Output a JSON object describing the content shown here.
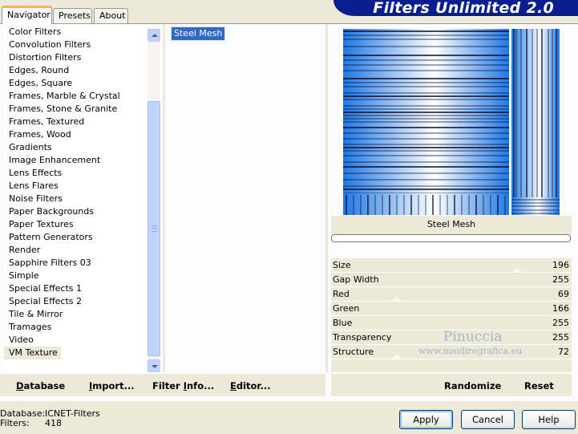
{
  "tabs": [
    {
      "label": "Navigator",
      "active": true
    },
    {
      "label": "Presets",
      "active": false
    },
    {
      "label": "About",
      "active": false
    }
  ],
  "brand": "Filters Unlimited 2.0",
  "categories": [
    "Color Filters",
    "Convolution Filters",
    "Distortion Filters",
    "Edges, Round",
    "Edges, Square",
    "Frames, Marble & Crystal",
    "Frames, Stone & Granite",
    "Frames, Textured",
    "Frames, Wood",
    "Gradients",
    "Image Enhancement",
    "Lens Effects",
    "Lens Flares",
    "Noise Filters",
    "Paper Backgrounds",
    "Paper Textures",
    "Pattern Generators",
    "Render",
    "Sapphire Filters 03",
    "Simple",
    "Special Effects 1",
    "Special Effects 2",
    "Tile & Mirror",
    "Tramages",
    "Video",
    "VM Texture"
  ],
  "selected_category": "VM Texture",
  "filters": [
    "Steel Mesh"
  ],
  "selected_filter": "Steel Mesh",
  "preview": {
    "name": "Steel Mesh",
    "colors": {
      "blue": "#1f78e6",
      "light": "#ffffff",
      "dark": "#0a0a2a"
    }
  },
  "params": [
    {
      "name": "Size",
      "value": "196"
    },
    {
      "name": "Gap Width",
      "value": "255"
    },
    {
      "name": "Red",
      "value": "69"
    },
    {
      "name": "Green",
      "value": "166"
    },
    {
      "name": "Blue",
      "value": "255"
    },
    {
      "name": "Transparency",
      "value": "255"
    },
    {
      "name": "Structure",
      "value": "72"
    }
  ],
  "left_buttons": {
    "database": {
      "underline": "D",
      "rest": "atabase"
    },
    "import": {
      "underline": "I",
      "rest": "mport..."
    },
    "filter_info": {
      "pre": "Filter ",
      "underline": "I",
      "rest": "nfo..."
    },
    "editor": {
      "underline": "E",
      "rest": "ditor..."
    }
  },
  "right_buttons": {
    "randomize": "Randomize",
    "reset": "Reset"
  },
  "status": {
    "database_key": "Database:",
    "database_value": "ICNET-Filters",
    "filters_key": "Filters:",
    "filters_value": "418"
  },
  "dialog_buttons": {
    "apply": "Apply",
    "cancel": "Cancel",
    "help": "Help"
  },
  "watermark": {
    "line1": "Pinuccia",
    "line2": "www.maidiregrafica.eu"
  }
}
